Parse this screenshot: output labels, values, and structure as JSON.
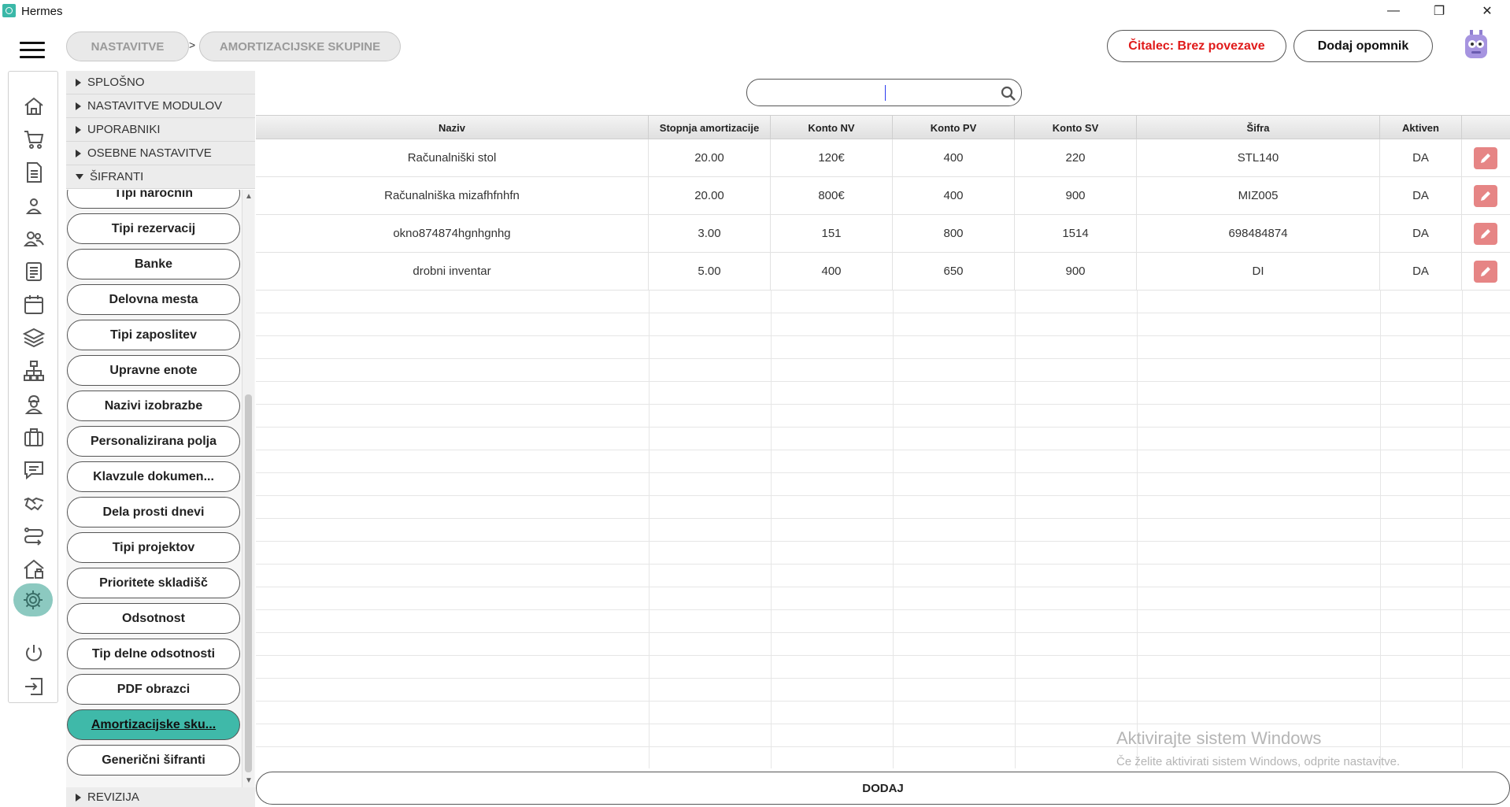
{
  "window": {
    "title": "Hermes",
    "minimize_glyph": "—",
    "restore_glyph": "❐",
    "close_glyph": "✕"
  },
  "breadcrumb": {
    "items": [
      "NASTAVITVE",
      "AMORTIZACIJSKE SKUPINE"
    ],
    "separator": ">"
  },
  "header": {
    "reader_status": "Čitalec: Brez povezave",
    "reader_status_color": "#e01a1a",
    "add_reminder": "Dodaj opomnik"
  },
  "rail": {
    "icons": [
      "home-icon",
      "cart-icon",
      "document-icon",
      "person-icon",
      "people-icon",
      "list-icon",
      "calendar-icon",
      "layers-icon",
      "network-icon",
      "worker-icon",
      "briefcase-icon",
      "chat-icon",
      "handshake-icon",
      "route-icon",
      "warehouse-icon",
      "settings-icon",
      "power-icon",
      "logout-icon"
    ],
    "active": "settings-icon",
    "active_color": "#8cc9c0"
  },
  "tree": {
    "sections": [
      {
        "label": "SPLOŠNO",
        "expanded": false
      },
      {
        "label": "NASTAVITVE MODULOV",
        "expanded": false
      },
      {
        "label": "UPORABNIKI",
        "expanded": false
      },
      {
        "label": "OSEBNE NASTAVITVE",
        "expanded": false
      },
      {
        "label": "ŠIFRANTI",
        "expanded": true
      }
    ],
    "sifranti_items": [
      "Tipi naročnin",
      "Tipi rezervacij",
      "Banke",
      "Delovna mesta",
      "Tipi zaposlitev",
      "Upravne enote",
      "Nazivi izobrazbe",
      "Personalizirana polja",
      "Klavzule dokumen...",
      "Dela prosti dnevi",
      "Tipi projektov",
      "Prioritete skladišč",
      "Odsotnost",
      "Tip delne odsotnosti",
      "PDF obrazci",
      "Amortizacijske sku...",
      "Generični šifranti"
    ],
    "active_item": "Amortizacijske sku...",
    "active_color": "#3fb9a9",
    "last_section": "REVIZIJA"
  },
  "search": {
    "value": "",
    "placeholder": ""
  },
  "table": {
    "columns": [
      "Naziv",
      "Stopnja amortizacije",
      "Konto NV",
      "Konto PV",
      "Konto SV",
      "Šifra",
      "Aktiven"
    ],
    "rows": [
      [
        "Računalniški stol",
        "20.00",
        "120€",
        "400",
        "220",
        "STL140",
        "DA"
      ],
      [
        "Računalniška mizafhfnhfn",
        "20.00",
        "800€",
        "400",
        "900",
        "MIZ005",
        "DA"
      ],
      [
        "okno874874hgnhgnhg",
        "3.00",
        "151",
        "800",
        "1514",
        "698484874",
        "DA"
      ],
      [
        "drobni inventar",
        "5.00",
        "400",
        "650",
        "900",
        "DI",
        "DA"
      ]
    ],
    "edit_color": "#e68585"
  },
  "watermark": {
    "line1": "Aktivirajte sistem Windows",
    "line2": "Če želite aktivirati sistem Windows, odprite nastavitve."
  },
  "footer": {
    "add_label": "DODAJ"
  }
}
